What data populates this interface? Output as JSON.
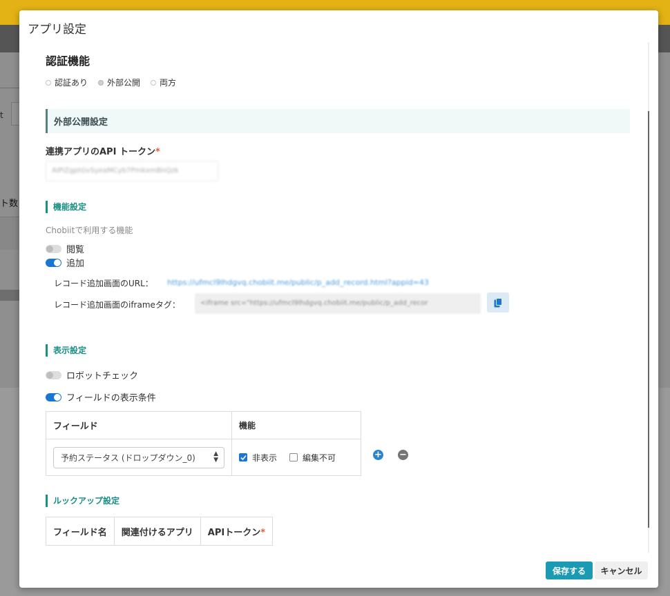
{
  "background": {
    "left_mark": "t",
    "left_count_label": "ト数"
  },
  "modal": {
    "title": "アプリ設定"
  },
  "auth": {
    "heading": "認証機能",
    "options": [
      "認証あり",
      "外部公開",
      "両方"
    ],
    "selected": "外部公開"
  },
  "external": {
    "section_title": "外部公開設定",
    "token_label": "連携アプリのAPI トークン",
    "required_mark": "*",
    "token_value": "AIPiZgptGvSyeaMCyb7PmkxmBnQzk"
  },
  "features": {
    "heading": "機能設定",
    "description": "Chobiitで利用する機能",
    "view_label": "閲覧",
    "view_enabled": false,
    "add_label": "追加",
    "add_enabled": true,
    "url_label": "レコード追加画面のURL：",
    "url_value": "https://ufmcl9lhdgvq.chobiit.me/public/p_add_record.html?appid=43",
    "iframe_label": "レコード追加画面のiframeタグ：",
    "iframe_value": "<iframe src=\"https://ufmcl9lhdgvq.chobiit.me/public/p_add_recor",
    "copy_icon": "copy-icon"
  },
  "display": {
    "heading": "表示設定",
    "robot_label": "ロボットチェック",
    "robot_enabled": false,
    "field_cond_label": "フィールドの表示条件",
    "field_cond_enabled": true,
    "table": {
      "col_field": "フィールド",
      "col_function": "機能",
      "row_select_value": "予約ステータス (ドロップダウン_0)",
      "hide_label": "非表示",
      "hide_checked": true,
      "noedit_label": "編集不可",
      "noedit_checked": false
    }
  },
  "lookup": {
    "heading": "ルックアップ設定",
    "col_field_name": "フィールド名",
    "col_related_app": "関連付けるアプリ",
    "col_api_token": "APIトークン",
    "required_mark": "*"
  },
  "footer": {
    "save_label": "保存する",
    "cancel_label": "キャンセル"
  },
  "colors": {
    "accent_teal": "#1a8f83",
    "save_button": "#1a9bb3",
    "toggle_on": "#1976d2",
    "required": "#e65c3a"
  }
}
